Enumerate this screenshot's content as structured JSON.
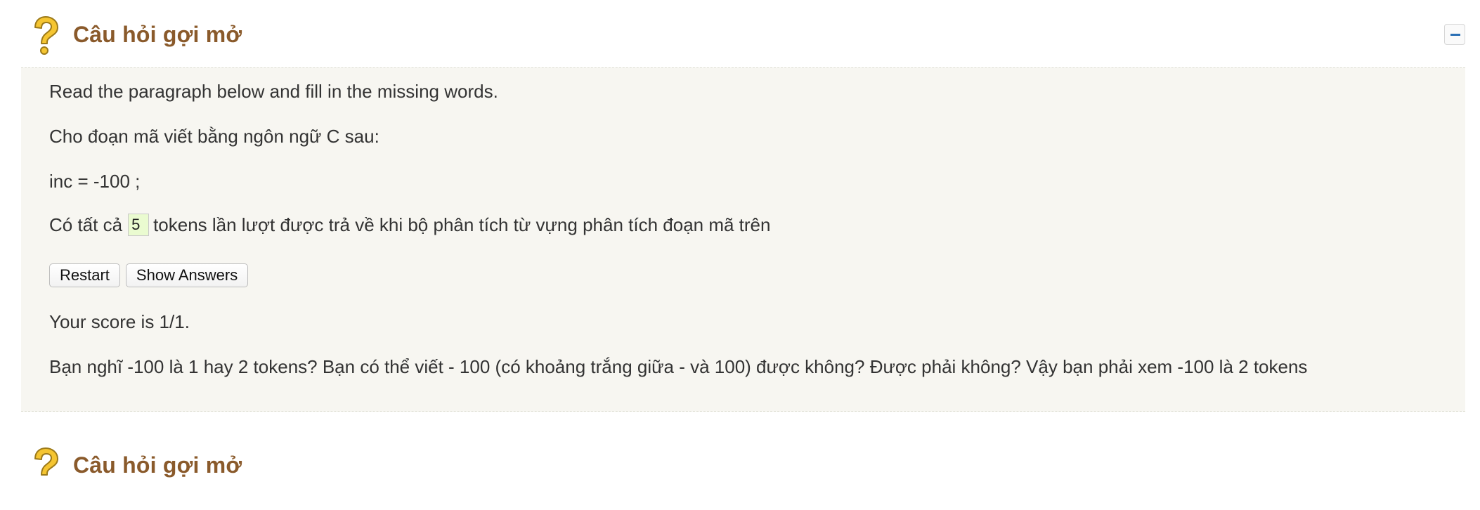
{
  "blocks": [
    {
      "title": "Câu hỏi gợi mở",
      "icon": "question-mark-icon",
      "collapse_icon": "minus-icon",
      "instruction": "Read the paragraph below and fill in the missing words.",
      "prompt": "Cho đoạn mã viết bằng ngôn ngữ C sau:",
      "code": "inc = -100 ;",
      "fill_sentence": {
        "before": "Có tất cả",
        "answer": "5",
        "after": "tokens lần lượt được trả về khi bộ phân tích từ vựng phân tích đoạn mã trên"
      },
      "buttons": {
        "restart": "Restart",
        "show_answers": "Show Answers"
      },
      "score": "Your score is 1/1.",
      "feedback": "Bạn nghĩ -100 là 1 hay 2 tokens? Bạn có thể viết - 100 (có khoảng trắng giữa - và 100) được không? Được phải không? Vậy bạn phải xem -100 là 2 tokens"
    },
    {
      "title": "Câu hỏi gợi mở",
      "icon": "question-mark-icon"
    }
  ],
  "colors": {
    "title": "#8a5a2b",
    "body_background": "#f7f6f1",
    "input_background": "#eafbd0",
    "icon_fill": "#f5c531",
    "icon_stroke": "#9c7a1a",
    "collapse_bar": "#2a6fb5"
  }
}
